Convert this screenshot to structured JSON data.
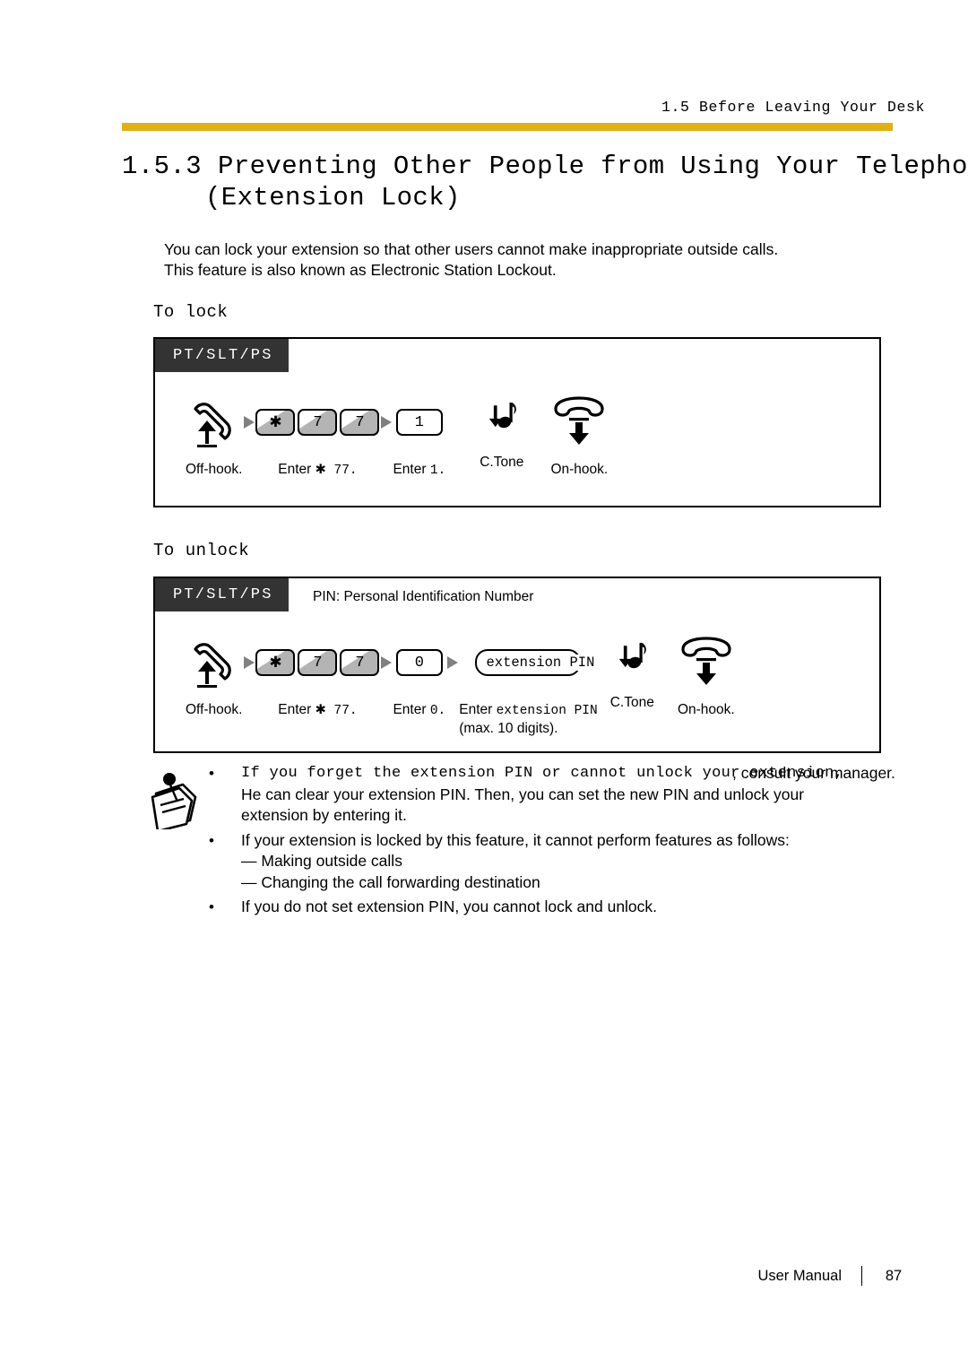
{
  "header": {
    "running_head": "1.5 Before Leaving Your Desk"
  },
  "title": {
    "number": "1.5.3",
    "line1": "Preventing Other People from Using Your Telephone",
    "line2": "(Extension Lock)"
  },
  "intro": {
    "line1": "You can lock your extension so that other users cannot make inappropriate outside calls.",
    "line2": "This feature is also known as Electronic Station Lockout."
  },
  "sections": [
    {
      "heading": "To lock",
      "badge": "PT/SLT/PS",
      "legend": "",
      "steps": [
        {
          "icon": "off-hook-handset-icon",
          "caption": "Off-hook."
        },
        {
          "icon": "keypad",
          "keys": [
            "✱",
            "7",
            "7"
          ],
          "caption_prefix": "Enter ",
          "caption_mono": "✱ 77."
        },
        {
          "icon": "keypad-plain",
          "keys": [
            "1"
          ],
          "caption_prefix": "Enter ",
          "caption_mono": "1."
        },
        {
          "icon": "confirmation-tone-icon",
          "caption": "C.Tone"
        },
        {
          "icon": "on-hook-handset-icon",
          "caption": "On-hook."
        }
      ]
    },
    {
      "heading": "To unlock",
      "badge": "PT/SLT/PS",
      "legend": "PIN: Personal Identification Number",
      "steps": [
        {
          "icon": "off-hook-handset-icon",
          "caption": "Off-hook."
        },
        {
          "icon": "keypad",
          "keys": [
            "✱",
            "7",
            "7"
          ],
          "caption_prefix": "Enter ",
          "caption_mono": "✱ 77."
        },
        {
          "icon": "keypad-plain",
          "keys": [
            "0"
          ],
          "caption_prefix": "Enter ",
          "caption_mono": "0."
        },
        {
          "icon": "pin-entry-box",
          "box_text": "extension PIN",
          "caption_prefix": "Enter ",
          "caption_mono": "extension PIN",
          "caption_line2": "(max. 10 digits)."
        },
        {
          "icon": "confirmation-tone-icon",
          "caption": "C.Tone"
        },
        {
          "icon": "on-hook-handset-icon",
          "caption": "On-hook."
        }
      ]
    }
  ],
  "notes": {
    "icon": "note-memo-icon",
    "bullet": "•",
    "items": [
      {
        "overlap_mono": "If you forget the extension PIN or cannot unlock your extension,",
        "overlap_sans": ", consult your manager.",
        "line2": "He can clear your extension PIN. Then, you can set the new PIN and unlock your",
        "line3": "extension by entering it."
      },
      {
        "line1": "If your extension is locked by this feature, it cannot perform features as follows:",
        "sub1": "— Making outside calls",
        "sub2": "— Changing the call forwarding destination"
      },
      {
        "line1": "If you do not set extension PIN, you cannot lock and unlock."
      }
    ]
  },
  "footer": {
    "manual_label": "User Manual",
    "page_number": "87"
  },
  "colors": {
    "rule": "#e0b016",
    "badge_bg": "#333333",
    "key_shade": "#b4b4b4"
  }
}
